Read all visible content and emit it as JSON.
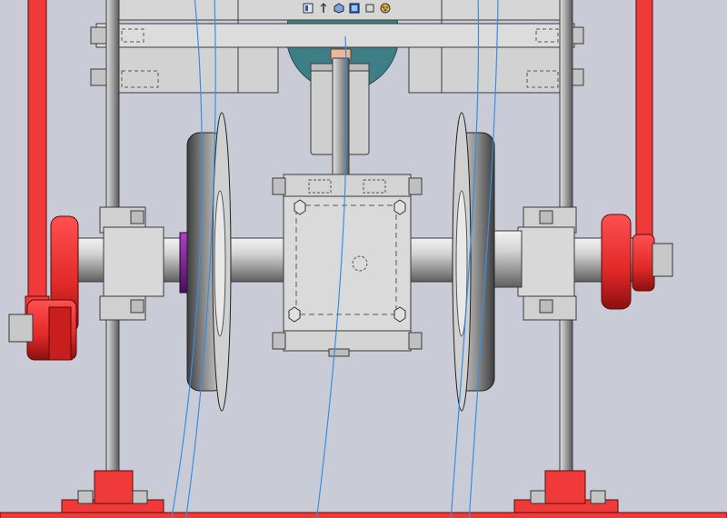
{
  "app": {
    "type": "3d-cad-viewport",
    "background_color": "#c9ccd6"
  },
  "hud_toolbar": {
    "icons": [
      "view-orientation-icon",
      "section-view-icon",
      "display-style-icon",
      "view-cube-icon",
      "hide-show-icon",
      "appearance-icon"
    ]
  },
  "colors": {
    "frame_red": "#f03a3a",
    "metal_gray": "#b4b6bb",
    "plate_gray": "#d6d6d6",
    "edge_dark": "#3a3a3a",
    "sketch_blue": "#3b8de0",
    "collar_purple": "#7a1e8c",
    "teal_disc": "#3c7f86",
    "bronze": "#e8b898"
  }
}
